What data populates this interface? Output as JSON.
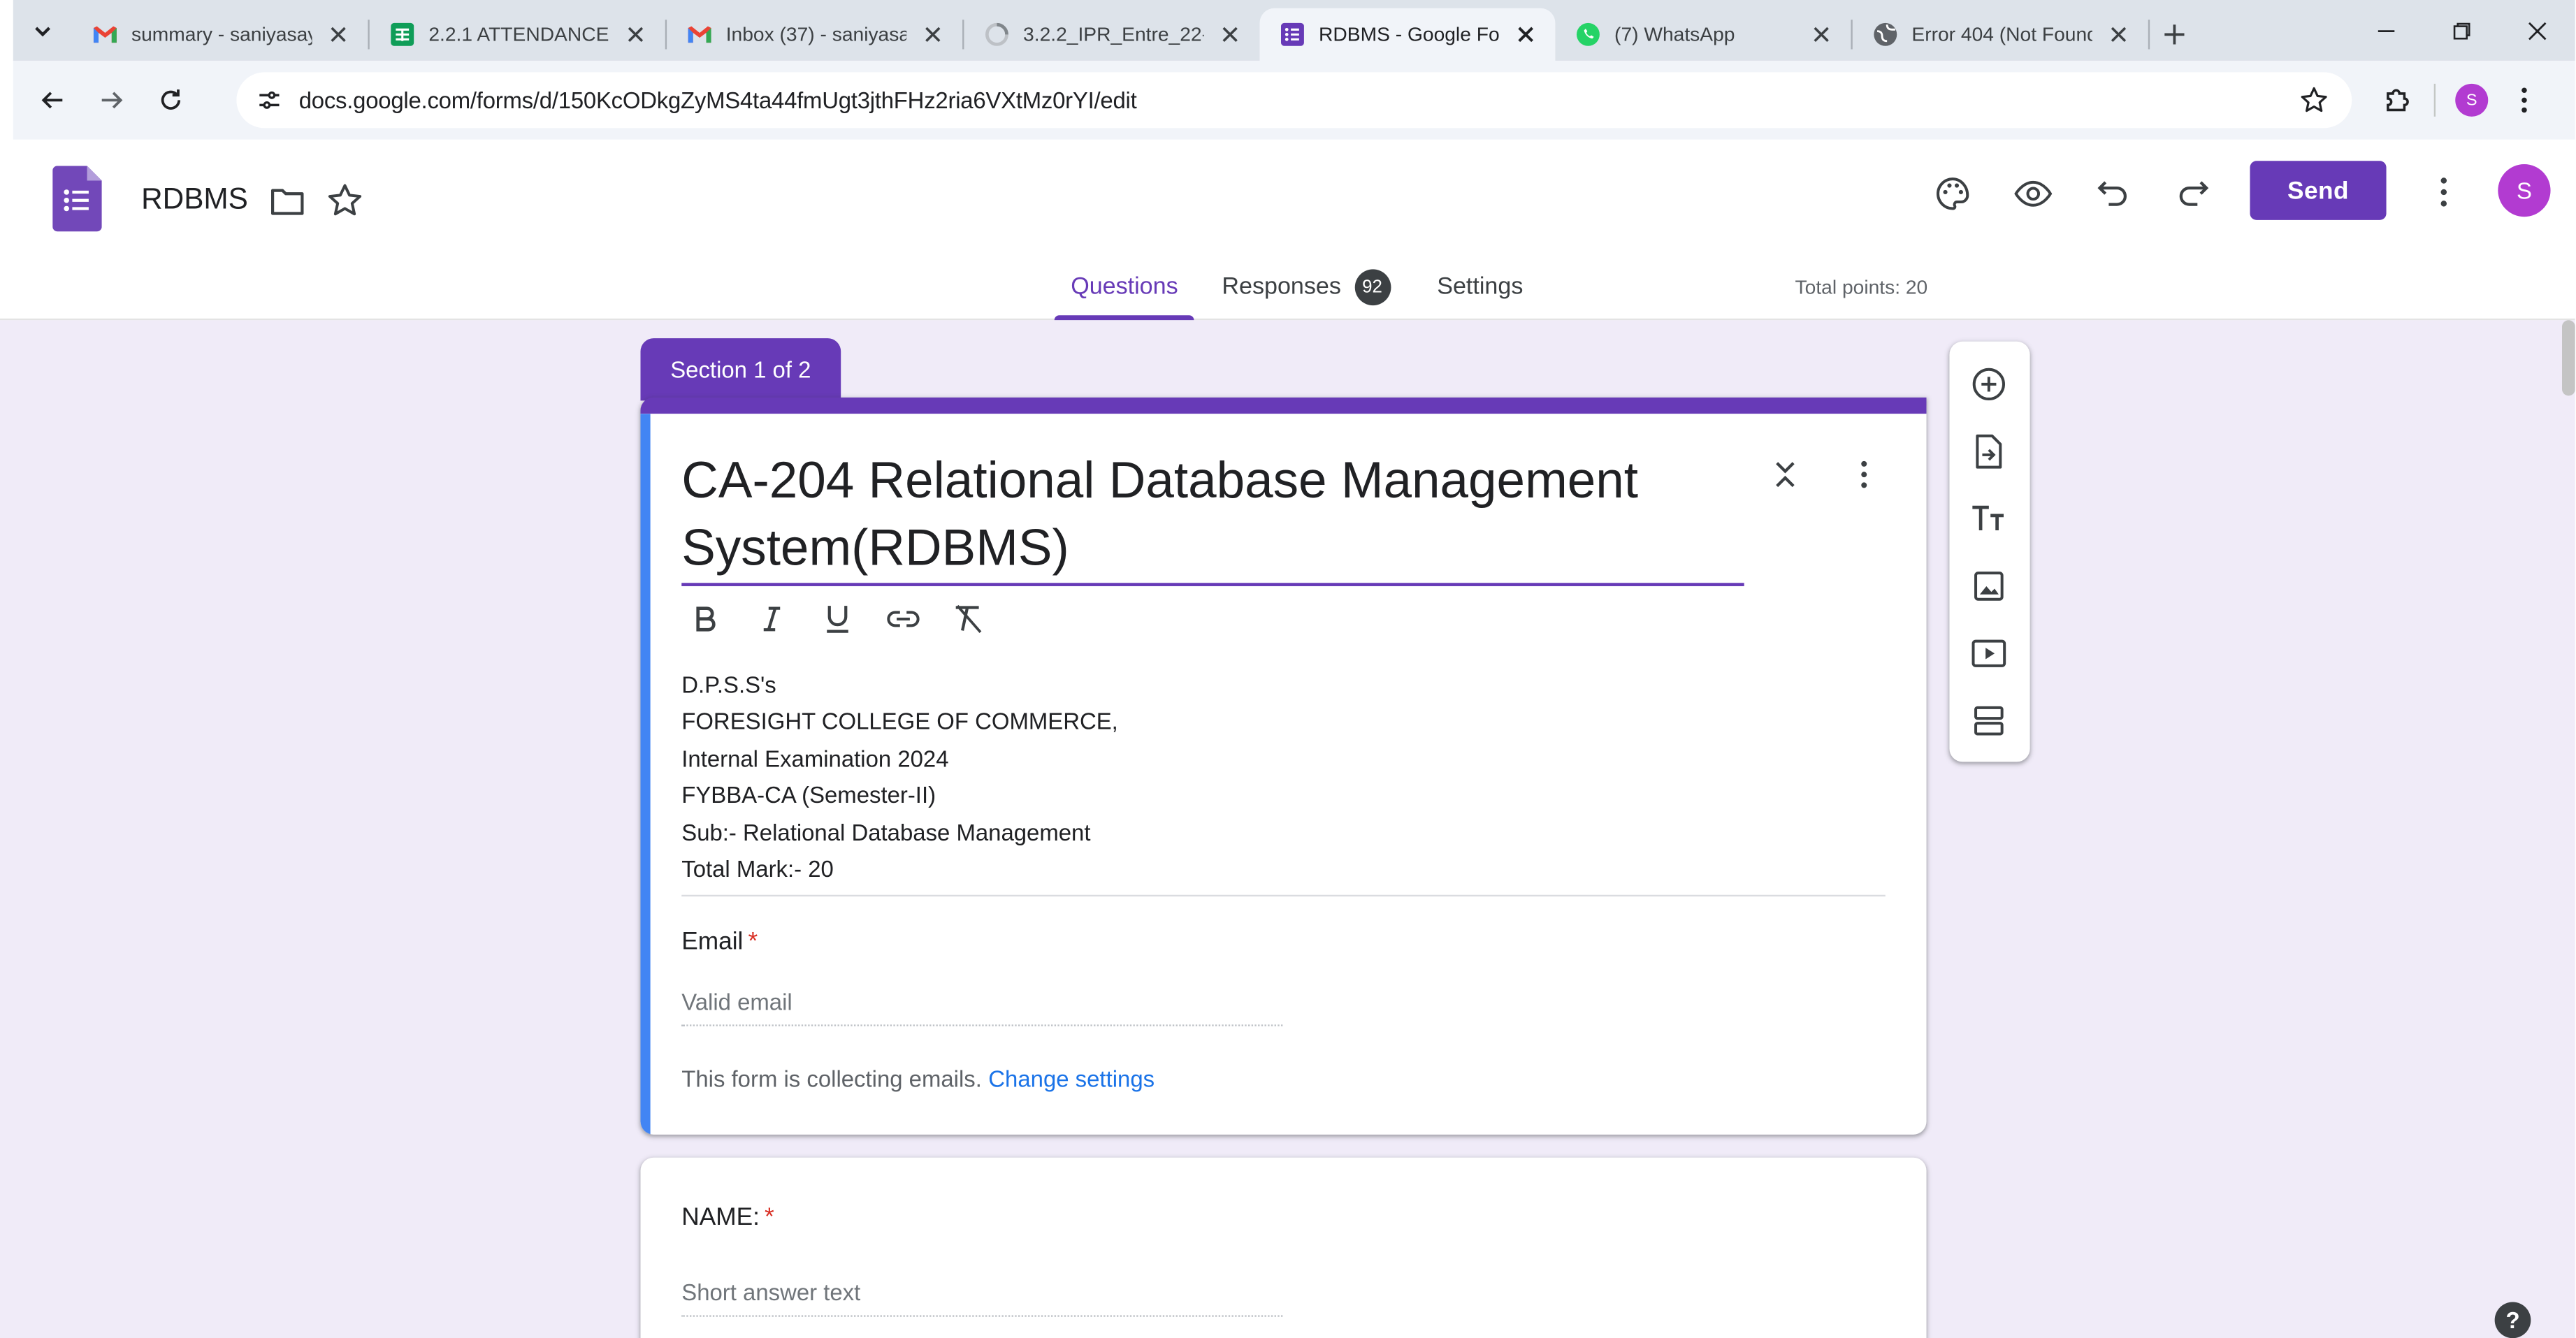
{
  "browser": {
    "tabs": [
      {
        "title": "summary - saniyasay",
        "icon": "gmail-icon"
      },
      {
        "title": "2.2.1 ATTENDANCE S",
        "icon": "sheets-icon"
      },
      {
        "title": "Inbox (37) - saniyasa",
        "icon": "gmail-icon"
      },
      {
        "title": "3.2.2_IPR_Entre_22-2",
        "icon": "loading-icon"
      },
      {
        "title": "RDBMS - Google For",
        "icon": "forms-icon",
        "active": true
      },
      {
        "title": "(7) WhatsApp",
        "icon": "whatsapp-icon"
      },
      {
        "title": "Error 404 (Not Found",
        "icon": "globe-icon"
      }
    ],
    "url": "docs.google.com/forms/d/150KcODkgZyMS4ta44fmUgt3jthFHz2ria6VXtMz0rYI/edit",
    "profile_initial": "S"
  },
  "header": {
    "doc_title": "RDBMS",
    "send_label": "Send",
    "avatar_initial": "S",
    "tabs": {
      "questions": "Questions",
      "responses": "Responses",
      "responses_count": "92",
      "settings": "Settings"
    },
    "total_points": "Total points: 20"
  },
  "section": {
    "label": "Section 1 of 2"
  },
  "form": {
    "title": "CA-204 Relational Database Management System(RDBMS)",
    "description_lines": [
      "D.P.S.S's",
      "FORESIGHT COLLEGE OF COMMERCE,",
      "Internal Examination 2024",
      "FYBBA-CA (Semester-II)",
      "Sub:- Relational Database Management",
      "Total Mark:- 20"
    ],
    "email_label": "Email",
    "email_placeholder": "Valid email",
    "collecting_note": "This form is collecting emails.",
    "change_settings": "Change settings",
    "required_mark": "*"
  },
  "questions": [
    {
      "label": "NAME:",
      "required": true,
      "placeholder": "Short answer text"
    }
  ],
  "help_label": "?",
  "colors": {
    "accent": "#673ab7",
    "focus_bar": "#4285f4",
    "canvas": "#f0ebf8",
    "link": "#1a73e8",
    "required": "#d93025"
  }
}
